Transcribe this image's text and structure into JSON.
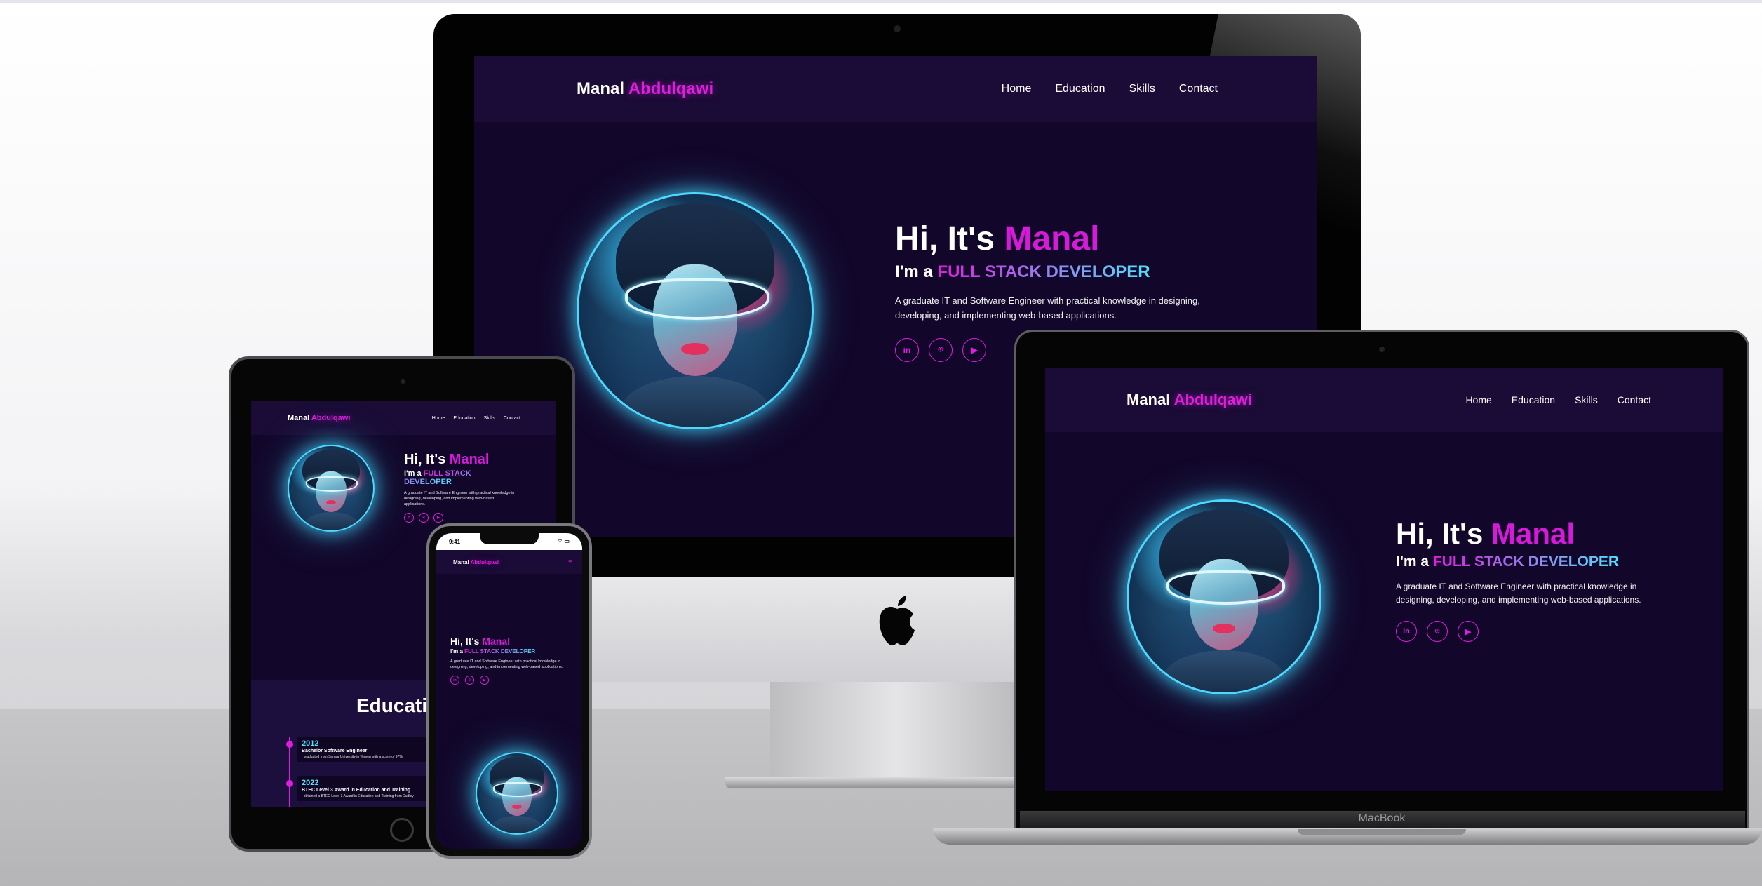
{
  "site": {
    "logo_first": "Manal",
    "logo_last": "Abdulqawi",
    "nav": [
      "Home",
      "Education",
      "Skills",
      "Contact"
    ],
    "hero": {
      "greeting": "Hi, It's",
      "name": "Manal",
      "role_prefix": "I'm a",
      "role": "FULL STACK DEVELOPER",
      "description": "A graduate IT and Software Engineer with practical knowledge in designing, developing, and implementing web-based applications.",
      "socials": [
        {
          "icon": "linkedin-icon",
          "glyph": "in"
        },
        {
          "icon": "github-icon",
          "glyph": "⌾"
        },
        {
          "icon": "youtube-icon",
          "glyph": "▶"
        }
      ]
    },
    "education": {
      "title": "Educati",
      "items": [
        {
          "year": "2012",
          "title": "Bachelor Software Engineer",
          "desc": "I graduated from Sana'a University in Yemen with a score of 97%."
        },
        {
          "year": "2022",
          "title": "BTEC Level 3 Award in Education and Training",
          "desc": "I obtained a BTEC Level 3 Award in Education and Training from Dudley"
        }
      ]
    }
  },
  "devices": {
    "macbook_label": "MacBook",
    "phone_time": "9:41"
  },
  "colors": {
    "background": "#12072a",
    "nav_background": "#1a0c36",
    "accent_magenta": "#e11be0",
    "accent_cyan": "#4fe2ff"
  }
}
